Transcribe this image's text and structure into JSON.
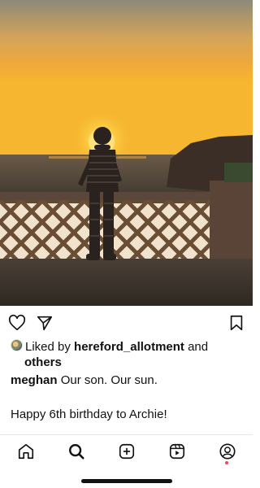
{
  "post": {
    "liked_prefix": "Liked by",
    "liked_user": "hereford_allotment",
    "liked_and": "and",
    "liked_others": "others",
    "username": "meghan",
    "caption_line1": "Our son. Our sun.",
    "caption_line2": "Happy 6th birthday to Archie!"
  },
  "icons": [
    "heart-icon",
    "share-icon",
    "bookmark-icon",
    "home-icon",
    "search-icon",
    "create-icon",
    "reels-icon",
    "profile-icon"
  ],
  "colors": {
    "notification_dot": "#ed4956",
    "sky_top": "#f0c07a",
    "sun": "#ffd64a"
  }
}
